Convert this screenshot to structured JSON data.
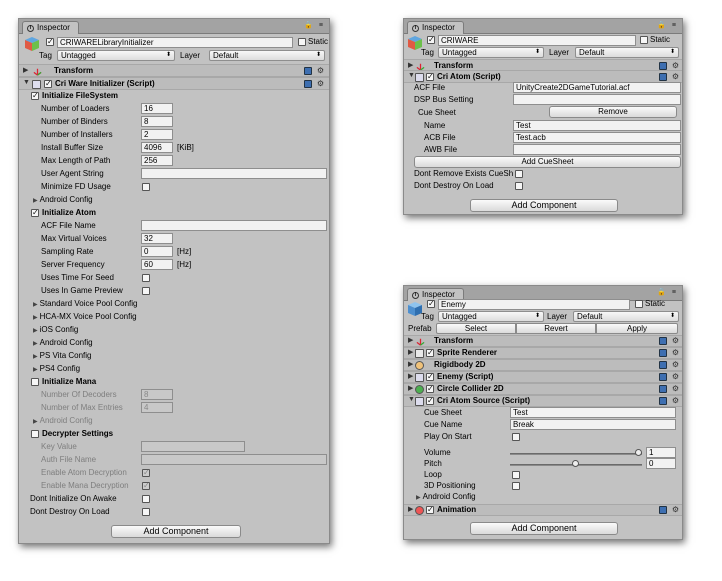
{
  "p1": {
    "tab": "Inspector",
    "object_name": "CRIWARELibraryInitializer",
    "static_label": "Static",
    "tag_label": "Tag",
    "tag_value": "Untagged",
    "layer_label": "Layer",
    "layer_value": "Default",
    "transform": "Transform",
    "script_title": "Cri Ware Initializer (Script)",
    "fs_header": "Initialize FileSystem",
    "fs": [
      {
        "label": "Number of Loaders",
        "value": "16"
      },
      {
        "label": "Number of Binders",
        "value": "8"
      },
      {
        "label": "Number of Installers",
        "value": "2"
      },
      {
        "label": "Install Buffer Size",
        "value": "4096",
        "unit": "[KiB]"
      },
      {
        "label": "Max Length of Path",
        "value": "256"
      }
    ],
    "user_agent": "User Agent String",
    "minimize_fd": "Minimize FD Usage",
    "android_config": "Android Config",
    "atom_header": "Initialize Atom",
    "acf_file_name": "ACF File Name",
    "atom": [
      {
        "label": "Max Virtual Voices",
        "value": "32"
      },
      {
        "label": "Sampling Rate",
        "value": "0",
        "unit": "[Hz]"
      },
      {
        "label": "Server Frequency",
        "value": "60",
        "unit": "[Hz]"
      }
    ],
    "uses_time": "Uses Time For Seed",
    "uses_preview": "Uses In Game Preview",
    "configs": [
      "Standard Voice Pool Config",
      "HCA-MX Voice Pool Config",
      "iOS Config",
      "Android Config",
      "PS Vita Config",
      "PS4 Config"
    ],
    "mana_header": "Initialize Mana",
    "mana": [
      {
        "label": "Number Of Decoders",
        "value": "8"
      },
      {
        "label": "Number of Max Entries",
        "value": "4"
      }
    ],
    "mana_android": "Android Config",
    "decrypt_header": "Decrypter Settings",
    "key_value": "Key Value",
    "auth_file": "Auth File Name",
    "enable_atom_dec": "Enable Atom Decryption",
    "enable_mana_dec": "Enable Mana Decryption",
    "dont_init": "Dont Initialize On Awake",
    "dont_destroy": "Dont Destroy On Load",
    "add_component": "Add Component"
  },
  "p2": {
    "tab": "Inspector",
    "object_name": "CRIWARE",
    "static_label": "Static",
    "tag_label": "Tag",
    "tag_value": "Untagged",
    "layer_label": "Layer",
    "layer_value": "Default",
    "transform": "Transform",
    "script_title": "Cri Atom (Script)",
    "acf_label": "ACF File",
    "acf_value": "UnityCreate2DGameTutorial.acf",
    "dsp_label": "DSP Bus Setting",
    "cue_sheet": "Cue Sheet",
    "remove": "Remove",
    "name_label": "Name",
    "name_value": "Test",
    "acb_label": "ACB File",
    "acb_value": "Test.acb",
    "awb_label": "AWB File",
    "add_cuesheet": "Add CueSheet",
    "dont_remove": "Dont Remove Exists CueSh",
    "dont_destroy": "Dont Destroy On Load",
    "add_component": "Add Component"
  },
  "p3": {
    "tab": "Inspector",
    "object_name": "Enemy",
    "static_label": "Static",
    "tag_label": "Tag",
    "tag_value": "Untagged",
    "layer_label": "Layer",
    "layer_value": "Default",
    "prefab_label": "Prefab",
    "select": "Select",
    "revert": "Revert",
    "apply": "Apply",
    "components": [
      "Transform",
      "Sprite Renderer",
      "Rigidbody 2D",
      "Enemy (Script)",
      "Circle Collider 2D"
    ],
    "script_title": "Cri Atom Source (Script)",
    "cue_sheet_label": "Cue Sheet",
    "cue_sheet_value": "Test",
    "cue_name_label": "Cue Name",
    "cue_name_value": "Break",
    "play_on_start": "Play On Start",
    "volume_label": "Volume",
    "volume_value": "1",
    "pitch_label": "Pitch",
    "pitch_value": "0",
    "loop": "Loop",
    "positioning": "3D Positioning",
    "android_config": "Android Config",
    "animation": "Animation",
    "add_component": "Add Component"
  }
}
